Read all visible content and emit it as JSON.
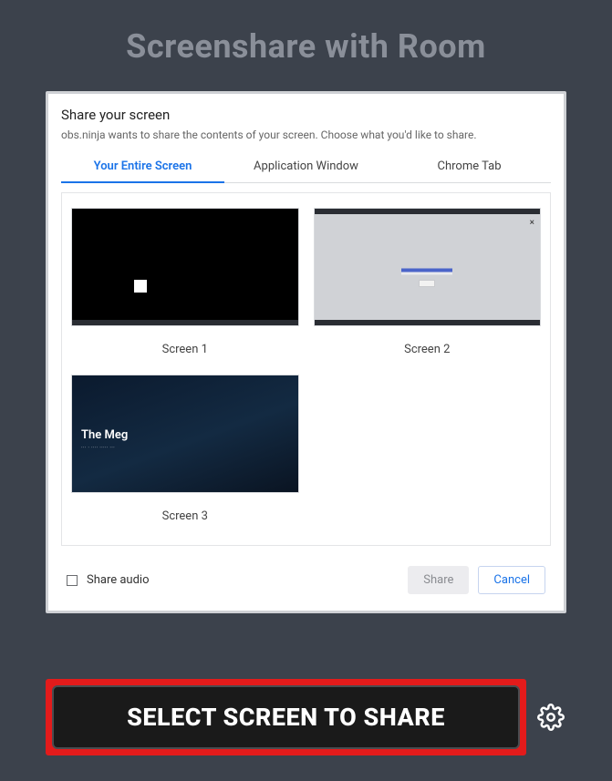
{
  "page": {
    "title": "Screenshare with Room"
  },
  "dialog": {
    "title": "Share your screen",
    "subtitle": "obs.ninja wants to share the contents of your screen. Choose what you'd like to share.",
    "tabs": [
      {
        "label": "Your Entire Screen",
        "active": true
      },
      {
        "label": "Application Window",
        "active": false
      },
      {
        "label": "Chrome Tab",
        "active": false
      }
    ],
    "screens": [
      {
        "label": "Screen 1",
        "thumb_movie_title": ""
      },
      {
        "label": "Screen 2",
        "thumb_movie_title": ""
      },
      {
        "label": "Screen 3",
        "thumb_movie_title": "The Meg"
      }
    ],
    "share_audio_label": "Share audio",
    "share_button": "Share",
    "cancel_button": "Cancel"
  },
  "footer": {
    "select_button": "SELECT SCREEN TO SHARE"
  }
}
